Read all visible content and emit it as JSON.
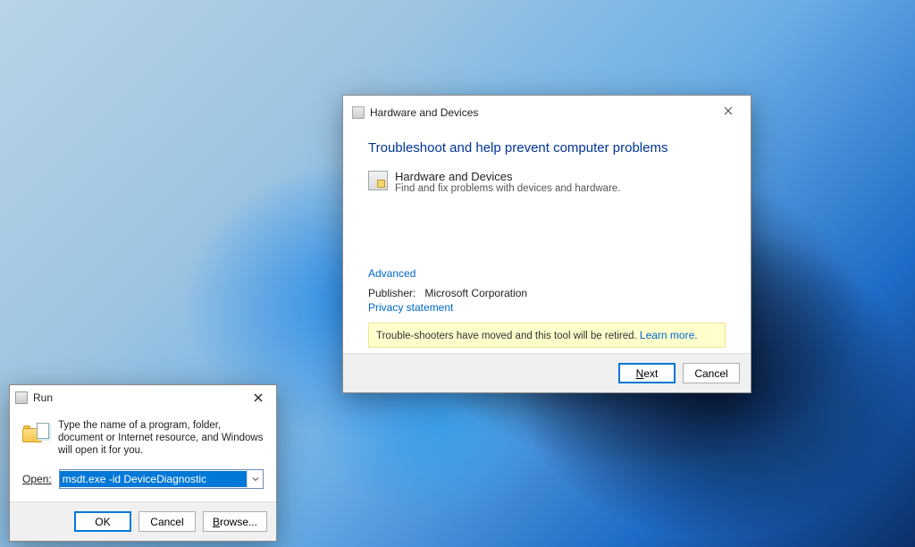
{
  "run": {
    "title": "Run",
    "description": "Type the name of a program, folder, document or Internet resource, and Windows will open it for you.",
    "open_label_prefix": "O",
    "open_label_rest": "pen:",
    "command": "msdt.exe -id DeviceDiagnostic",
    "ok": "OK",
    "cancel": "Cancel",
    "browse_prefix": "B",
    "browse_rest": "rowse..."
  },
  "wizard": {
    "window_title": "Hardware and Devices",
    "heading": "Troubleshoot and help prevent computer problems",
    "item_title": "Hardware and Devices",
    "item_desc": "Find and fix problems with devices and hardware.",
    "advanced": "Advanced",
    "publisher_label": "Publisher:",
    "publisher_value": "Microsoft Corporation",
    "privacy": "Privacy statement",
    "notice_text": "Trouble-shooters have moved and this tool will be retired. ",
    "learn_more": "Learn more.",
    "next_prefix": "N",
    "next_rest": "ext",
    "cancel": "Cancel"
  }
}
